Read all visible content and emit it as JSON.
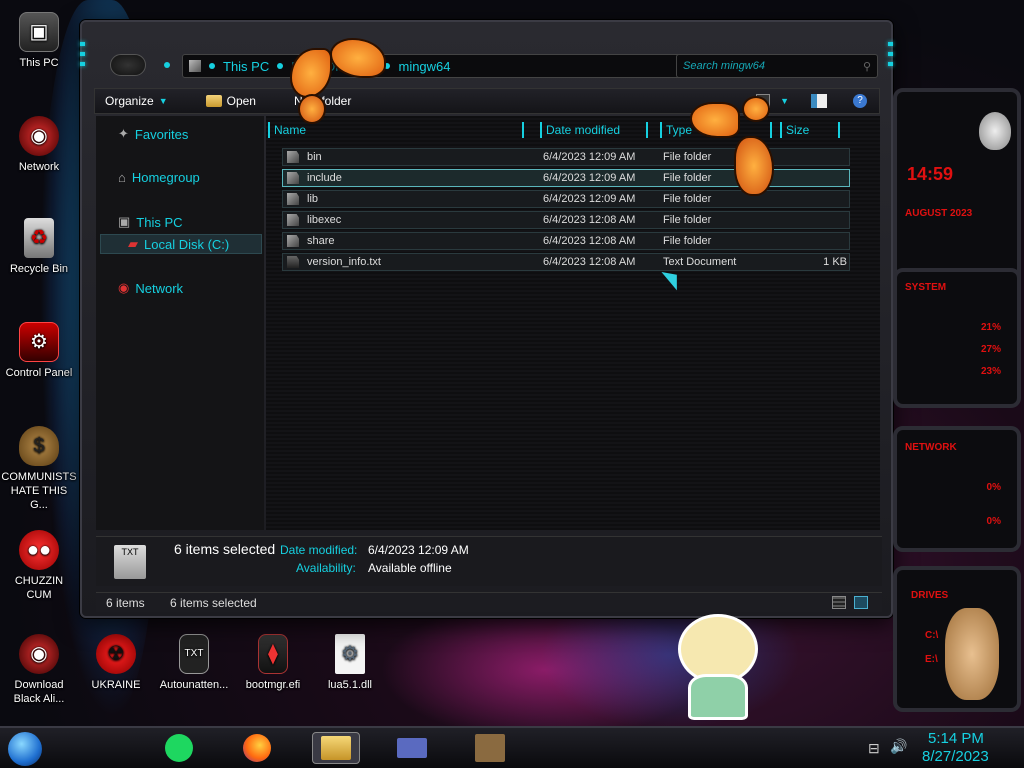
{
  "desktop": {
    "icons": [
      {
        "label": "This PC",
        "icon": "computer-icon"
      },
      {
        "label": "Network",
        "icon": "network-icon"
      },
      {
        "label": "Recycle Bin",
        "icon": "recycle-bin-icon"
      },
      {
        "label": "Control Panel",
        "icon": "control-panel-icon"
      },
      {
        "label": "COMMUNISTS HATE THIS G...",
        "icon": "money-bag-icon"
      },
      {
        "label": "CHUZZIN CUM",
        "icon": "chuzzle-icon"
      },
      {
        "label": "Download Black Ali...",
        "icon": "alienware-icon"
      },
      {
        "label": "UKRAINE",
        "icon": "radiation-icon"
      },
      {
        "label": "Autounatten...",
        "icon": "txt-file-icon"
      },
      {
        "label": "bootmgr.efi",
        "icon": "efi-file-icon"
      },
      {
        "label": "lua5.1.dll",
        "icon": "dll-file-icon"
      }
    ]
  },
  "explorer": {
    "address": {
      "segments": [
        "This PC",
        "Local Disk (C:)",
        "mingw64"
      ]
    },
    "search_placeholder": "Search mingw64",
    "toolbar": {
      "organize": "Organize",
      "open": "Open",
      "new_folder": "New folder"
    },
    "nav": {
      "favorites": "Favorites",
      "homegroup": "Homegroup",
      "this_pc": "This PC",
      "local_disk": "Local Disk (C:)",
      "network": "Network"
    },
    "columns": {
      "name": "Name",
      "date": "Date modified",
      "type": "Type",
      "size": "Size"
    },
    "files": [
      {
        "name": "bin",
        "date": "6/4/2023 12:09 AM",
        "type": "File folder",
        "size": ""
      },
      {
        "name": "include",
        "date": "6/4/2023 12:09 AM",
        "type": "File folder",
        "size": ""
      },
      {
        "name": "lib",
        "date": "6/4/2023 12:09 AM",
        "type": "File folder",
        "size": ""
      },
      {
        "name": "libexec",
        "date": "6/4/2023 12:08 AM",
        "type": "File folder",
        "size": ""
      },
      {
        "name": "share",
        "date": "6/4/2023 12:08 AM",
        "type": "File folder",
        "size": ""
      },
      {
        "name": "version_info.txt",
        "date": "6/4/2023 12:08 AM",
        "type": "Text Document",
        "size": "1 KB"
      }
    ],
    "details": {
      "selected": "6 items selected",
      "date_label": "Date modified:",
      "date_value": "6/4/2023 12:09 AM",
      "avail_label": "Availability:",
      "avail_value": "Available offline"
    },
    "status": {
      "count": "6 items",
      "selected": "6 items selected"
    }
  },
  "widgets": {
    "time": "14:59",
    "date": "AUGUST 2023",
    "system_title": "SYSTEM",
    "system_values": [
      "21%",
      "27%",
      "23%"
    ],
    "network_title": "NETWORK",
    "network_values": [
      "0%",
      "0%"
    ],
    "drives_title": "DRIVES",
    "drives": [
      "C:\\",
      "E:\\"
    ]
  },
  "taskbar": {
    "clock_time": "5:14 PM",
    "clock_date": "8/27/2023",
    "apps": [
      "start-orb-icon",
      "spotify-icon",
      "firefox-icon",
      "explorer-icon",
      "card-app-icon",
      "box-app-icon"
    ]
  },
  "colors": {
    "accent": "#16d0e0",
    "widget_red": "#e01010",
    "window_bg": "#1b1b20"
  }
}
